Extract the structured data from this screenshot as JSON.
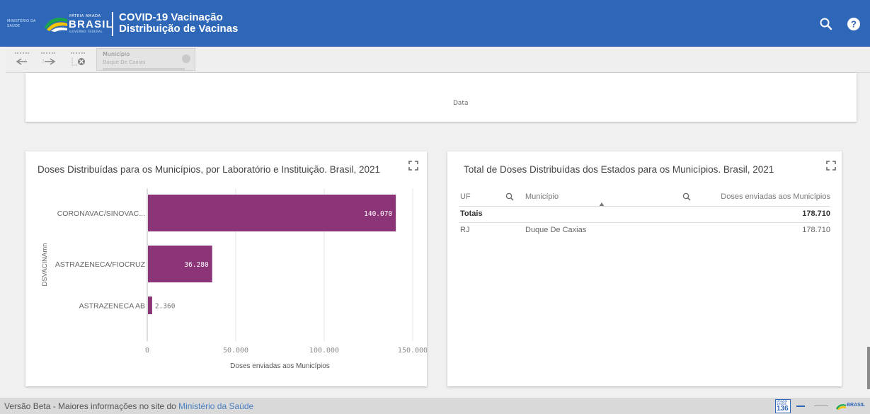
{
  "header": {
    "ministerio_text": "MINISTÉRIO DA SAÚDE",
    "patria_text": "PÁTRIA AMADA",
    "brasil_text": "BRASIL",
    "brasil_sub": "GOVERNO FEDERAL",
    "title_line1": "COVID-19 Vacinação",
    "title_line2": "Distribuição de Vacinas",
    "brand_color": "#2e67b8",
    "icons": [
      "search-icon",
      "help-icon"
    ]
  },
  "toolbar": {
    "buttons": [
      "step-back-icon",
      "step-forward-icon",
      "clear-selections-icon"
    ],
    "selection": {
      "field": "Município",
      "value": "Duque De Caxias"
    }
  },
  "top_chart": {
    "axis_title": "Data"
  },
  "bar_chart": {
    "title": "Doses Distribuídas para os Municípios, por Laboratório e Instituição. Brasil, 2021",
    "bar_color": "#8b3477",
    "chart_data": {
      "type": "bar",
      "orientation": "horizontal",
      "categories": [
        "CORONAVAC/SINOVAC...",
        "ASTRAZENECA/FIOCRUZ",
        "ASTRAZENECA AB"
      ],
      "values": [
        140070,
        36280,
        2360
      ],
      "value_labels": [
        "140.070",
        "36.280",
        "2.360"
      ],
      "xlabel": "Doses enviadas aos Municípios",
      "ylabel": "DSVACINAmn",
      "xlim": [
        0,
        150000
      ],
      "xticks": [
        0,
        50000,
        100000,
        150000
      ],
      "xtick_labels": [
        "0",
        "50.000",
        "100.000",
        "150.000"
      ],
      "grid": true
    }
  },
  "table": {
    "title": "Total de Doses Distribuídas dos Estados para os Municípios. Brasil, 2021",
    "columns": [
      "UF",
      "Município",
      "Doses enviadas aos Municípios"
    ],
    "totals": {
      "label": "Totais",
      "value": "178.710"
    },
    "rows": [
      {
        "uf": "RJ",
        "municipio": "Duque De Caxias",
        "doses": "178.710"
      }
    ]
  },
  "footer": {
    "text": "Versão Beta - Maiores informações no site do ",
    "link": "Ministério da Saúde",
    "disque_label": "DISQUE SAÚDE",
    "disque_number": "136",
    "brasil_small": "BRASIL"
  }
}
